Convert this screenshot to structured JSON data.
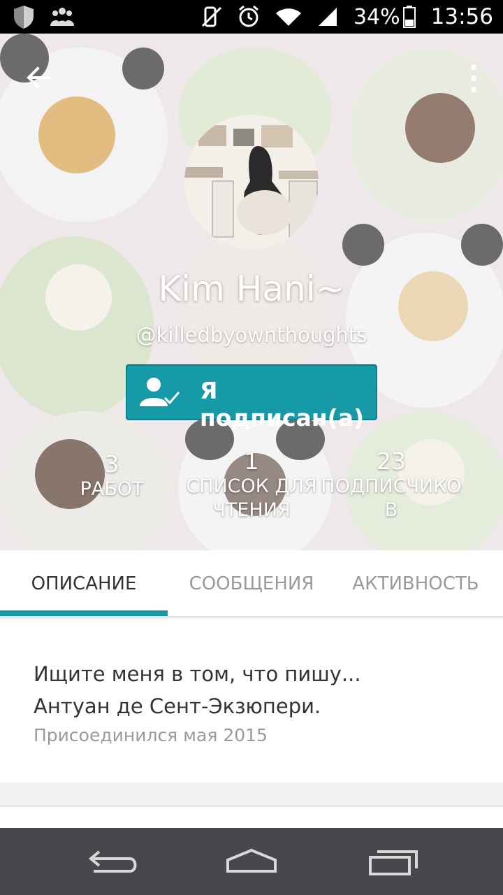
{
  "status_bar": {
    "battery": "34%",
    "time": "13:56"
  },
  "profile": {
    "name": "Kim Hani~",
    "handle": "@killedbyownthoughts",
    "follow_button": "Я подписан(а)"
  },
  "stats": [
    {
      "value": "3",
      "label_line1": "РАБОТ",
      "label_line2": ""
    },
    {
      "value": "1",
      "label_line1": "СПИСОК ДЛЯ",
      "label_line2": "ЧТЕНИЯ"
    },
    {
      "value": "23",
      "label_line1": "ПОДПИСЧИКО",
      "label_line2": "В"
    }
  ],
  "tabs": [
    {
      "label": "ОПИСАНИЕ",
      "active": true
    },
    {
      "label": "СООБЩЕНИЯ",
      "active": false
    },
    {
      "label": "АКТИВНОСТЬ",
      "active": false
    }
  ],
  "about": {
    "line1": "Ищите меня в том, что пишу...",
    "line2": "Антуан де Сент-Экзюпери.",
    "joined": "Присоединился мая 2015"
  },
  "colors": {
    "accent": "#179aa8",
    "navbar": "#49474b"
  }
}
